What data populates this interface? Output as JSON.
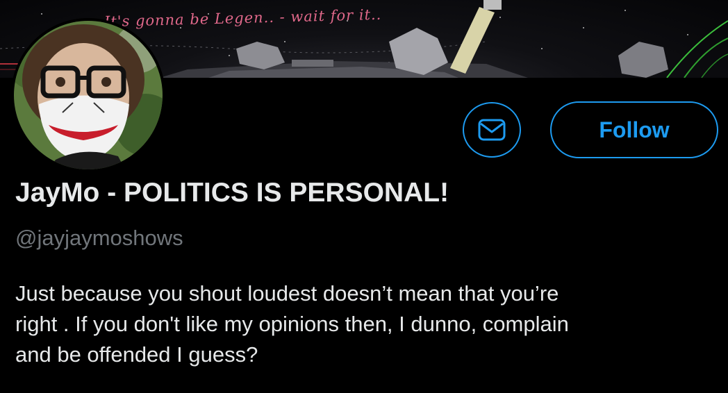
{
  "banner": {
    "caption": "It's gonna be Legen.. - wait for it.."
  },
  "profile": {
    "display_name": "JayMo - POLITICS IS PERSONAL!",
    "handle": "@jayjaymoshows",
    "bio_lines": [
      "Just because you shout loudest doesn’t mean that you’re",
      "right .  If you don't like my opinions then, I dunno, complain",
      "and be offended I guess?"
    ]
  },
  "actions": {
    "message_icon": "envelope-icon",
    "follow_label": "Follow"
  },
  "colors": {
    "accent": "#1d9bf0",
    "background": "#000000",
    "primary_text": "#e7e9ea",
    "secondary_text": "#71767b",
    "banner_caption": "#e0688a"
  }
}
